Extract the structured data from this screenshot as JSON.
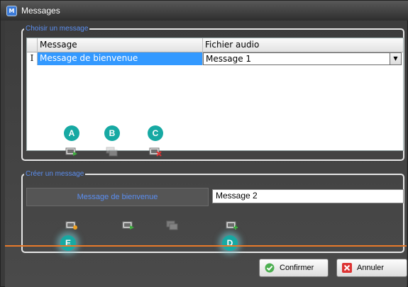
{
  "window": {
    "title": "Messages",
    "app_icon": "app-logo-icon"
  },
  "choose_group": {
    "legend": "Choisir un message",
    "columns": [
      "Message",
      "Fichier audio"
    ],
    "rows": [
      {
        "indicator": "I",
        "message": "Message de bienvenue",
        "audio": "Message 1"
      }
    ],
    "tools": [
      {
        "badge": "A",
        "icon": "play-message-icon",
        "enabled": true
      },
      {
        "badge": "B",
        "icon": "copy-message-icon",
        "enabled": false
      },
      {
        "badge": "C",
        "icon": "delete-message-icon",
        "enabled": true
      }
    ]
  },
  "create_group": {
    "legend": "Créer un message",
    "message_label": "Message de bienvenue",
    "name_value": "Message 2",
    "tools": [
      {
        "badge": "E",
        "icon": "record-message-icon",
        "enabled": true
      },
      {
        "badge": "",
        "icon": "play-message-icon",
        "enabled": true
      },
      {
        "badge": "",
        "icon": "copy-message-icon",
        "enabled": false
      },
      {
        "badge": "D",
        "icon": "add-message-icon",
        "enabled": true
      }
    ]
  },
  "footer": {
    "confirm_label": "Confirmer",
    "cancel_label": "Annuler"
  },
  "colors": {
    "accent": "#3399ff",
    "badge": "#17a9a3",
    "separator": "#e87a2a",
    "legend": "#5b8ef0"
  }
}
